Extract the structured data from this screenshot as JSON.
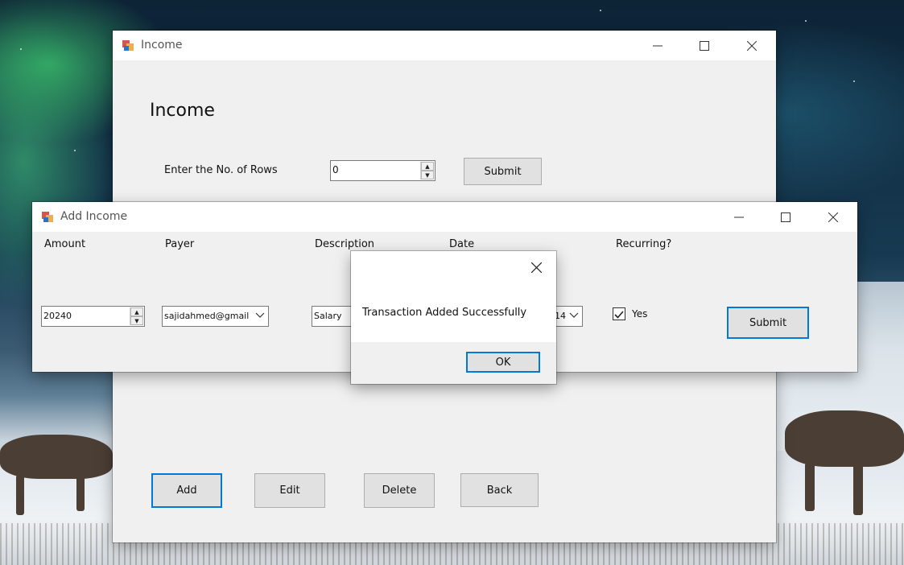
{
  "income_window": {
    "title": "Income",
    "heading": "Income",
    "rows_label": "Enter the No. of Rows",
    "rows_value": "0",
    "submit_label": "Submit",
    "add_label": "Add",
    "edit_label": "Edit",
    "delete_label": "Delete",
    "back_label": "Back"
  },
  "add_income_window": {
    "title": "Add Income",
    "columns": {
      "amount": "Amount",
      "payer": "Payer",
      "description": "Description",
      "date": "Date",
      "recurring": "Recurring?"
    },
    "amount_value": "20240",
    "payer_value": "sajidahmed@gmail",
    "description_value": "Salary",
    "date_value_visible": "14",
    "recurring_checked": true,
    "recurring_label": "Yes",
    "submit_label": "Submit"
  },
  "message_box": {
    "message": "Transaction Added Successfully",
    "ok_label": "OK"
  },
  "icons": {
    "app": "forms-app-icon",
    "minimize": "minimize-icon",
    "maximize": "maximize-icon",
    "close": "close-icon"
  }
}
